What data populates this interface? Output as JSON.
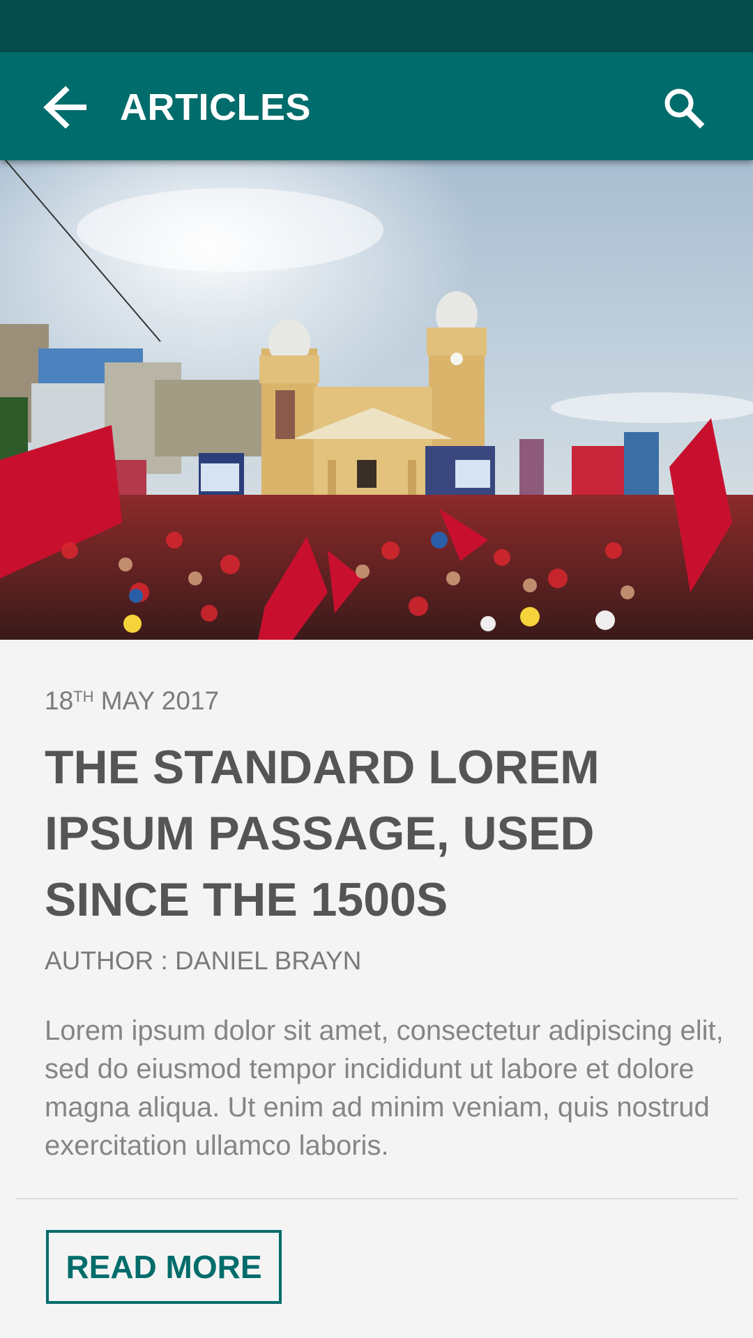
{
  "app_bar": {
    "title": "ARTICLES",
    "back_icon": "arrow-left-icon",
    "search_icon": "search-icon",
    "color": "#006c6b",
    "status_bar_color": "#064b4b"
  },
  "article": {
    "date_day": "18",
    "date_suffix": "TH",
    "date_rest": "MAY 2017",
    "title": "THE STANDARD LOREM IPSUM PASSAGE, USED SINCE THE 1500S",
    "author": "AUTHOR : DANIEL BRAYN",
    "excerpt": "Lorem ipsum dolor sit amet, consectetur adipiscing elit, sed do eiusmod tempor  incididunt ut labore et dolore magna aliqua. Ut enim ad minim veniam, quis nostrud exercitation ullamco laboris.",
    "read_more_label": "READ MORE"
  }
}
